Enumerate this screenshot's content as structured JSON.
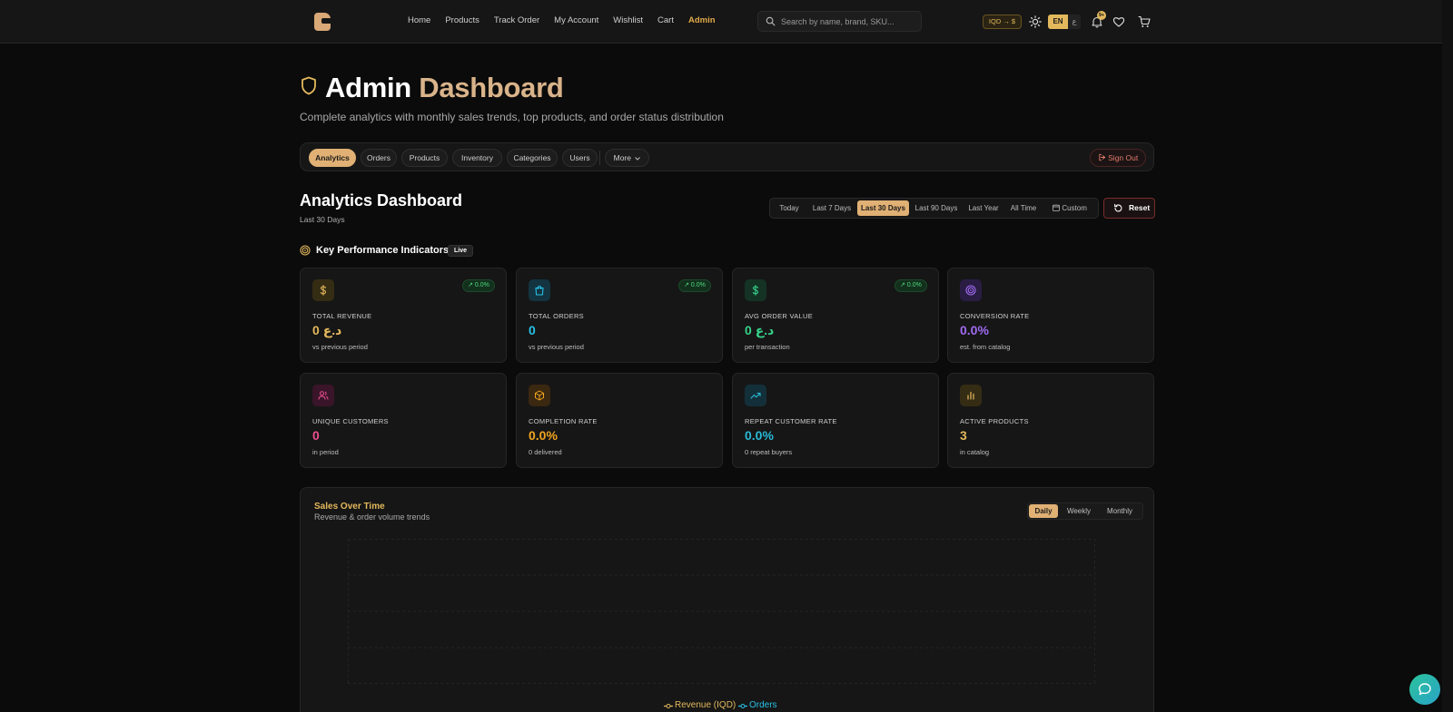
{
  "nav": {
    "links": [
      {
        "label": "Home"
      },
      {
        "label": "Products"
      },
      {
        "label": "Track Order"
      },
      {
        "label": "My Account"
      },
      {
        "label": "Wishlist"
      },
      {
        "label": "Cart"
      },
      {
        "label": "Admin",
        "active": true
      }
    ],
    "search_placeholder": "Search by name, brand, SKU...",
    "currency_label": "IQD → $",
    "lang_active": "EN",
    "lang_other": "ع",
    "notif_count": "9+"
  },
  "header": {
    "title_main": "Admin",
    "title_accent": "Dashboard",
    "subtitle": "Complete analytics with monthly sales trends, top products, and order status distribution"
  },
  "tabs": {
    "items": [
      "Analytics",
      "Orders",
      "Products",
      "Inventory",
      "Categories",
      "Users"
    ],
    "more": "More",
    "active": "Analytics",
    "sign_out": "Sign Out"
  },
  "analytics": {
    "title": "Analytics Dashboard",
    "subtitle": "Last 30 Days",
    "ranges": [
      "Today",
      "Last 7 Days",
      "Last 30 Days",
      "Last 90 Days",
      "Last Year",
      "All Time",
      "Custom"
    ],
    "active_range": "Last 30 Days",
    "reset_label": "Reset"
  },
  "kpi": {
    "heading": "Key Performance Indicators",
    "live": "Live",
    "cards": [
      {
        "label": "TOTAL REVENUE",
        "value": "0 د.ع",
        "note": "vs previous period",
        "delta": "↗ 0.0%",
        "icon": "dollar-icon",
        "color": "#e3b85c"
      },
      {
        "label": "TOTAL ORDERS",
        "value": "0",
        "note": "vs previous period",
        "delta": "↗ 0.0%",
        "icon": "shopping-bag-icon",
        "color": "#27c1e6"
      },
      {
        "label": "AVG ORDER VALUE",
        "value": "0 د.ع",
        "note": "per transaction",
        "delta": "↗ 0.0%",
        "icon": "dollar-icon",
        "color": "#36d18a"
      },
      {
        "label": "CONVERSION RATE",
        "value": "0.0%",
        "note": "est. from catalog",
        "icon": "target-icon",
        "color": "#a06af0"
      },
      {
        "label": "UNIQUE CUSTOMERS",
        "value": "0",
        "note": "in period",
        "icon": "users-icon",
        "color": "#ec4f8f"
      },
      {
        "label": "COMPLETION RATE",
        "value": "0.0%",
        "note": "0 delivered",
        "icon": "package-icon",
        "color": "#f2a51e"
      },
      {
        "label": "REPEAT CUSTOMER RATE",
        "value": "0.0%",
        "note": "0 repeat buyers",
        "icon": "trending-up-icon",
        "color": "#27b9d6"
      },
      {
        "label": "ACTIVE PRODUCTS",
        "value": "3",
        "note": "in catalog",
        "icon": "bar-chart-icon",
        "color": "#e3b85c"
      }
    ]
  },
  "sales": {
    "title": "Sales Over Time",
    "subtitle": "Revenue & order volume trends",
    "granularity": [
      "Daily",
      "Weekly",
      "Monthly"
    ],
    "active_granularity": "Daily",
    "legend": [
      {
        "name": "Revenue (IQD)",
        "color": "#e3b85c"
      },
      {
        "name": "Orders",
        "color": "#27c1e6"
      }
    ]
  },
  "chart_data": {
    "type": "line",
    "title": "Sales Over Time",
    "x": [],
    "series": [
      {
        "name": "Revenue (IQD)",
        "values": []
      },
      {
        "name": "Orders",
        "values": []
      }
    ],
    "grid": true,
    "legend": "bottom"
  }
}
